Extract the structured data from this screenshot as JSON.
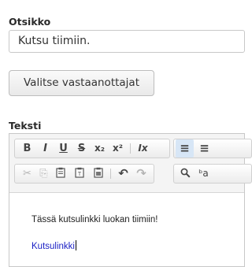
{
  "title_field": {
    "label": "Otsikko",
    "value": "Kutsu tiimiin."
  },
  "recipients_button": {
    "label": "Valitse vastaanottajat"
  },
  "text_field": {
    "label": "Teksti"
  },
  "toolbar": {
    "row1": {
      "bold": "B",
      "italic": "I",
      "underline": "U",
      "strikethrough": "S",
      "subscript": "x₂",
      "superscript": "x²",
      "remove_format": "Ix",
      "align_left": "≡",
      "align_center": "≡"
    },
    "row2": {
      "cut": "✂",
      "copy": "⎘",
      "paste": "📋",
      "paste_text": "📋",
      "paste_word": "📋",
      "undo": "↶",
      "redo": "↷",
      "find": "🔍",
      "replace": "ᵇa"
    }
  },
  "editor": {
    "paragraph": "Tässä kutsulinkki luokan tiimiin!",
    "link_text": "Kutsulinkki"
  }
}
